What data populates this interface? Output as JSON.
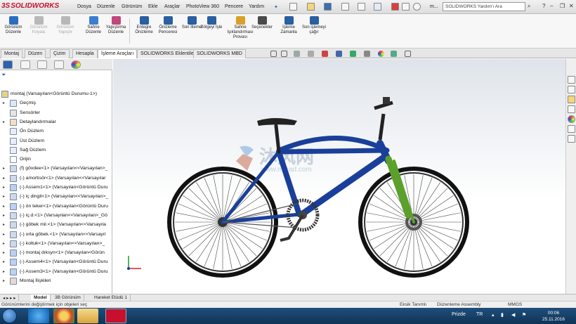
{
  "app": {
    "logo_ds": "3S",
    "logo_name": "SOLIDWORKS"
  },
  "menu": [
    "Dosya",
    "Düzenle",
    "Görünüm",
    "Ekle",
    "Araçlar",
    "PhotoView 360",
    "Pencere",
    "Yardım"
  ],
  "search": {
    "placeholder": "SOLIDWORKS Yardım'ı Ara",
    "user": "m..."
  },
  "ribbon": [
    {
      "label": "Görünüm Düzenle",
      "disabled": false,
      "color": "#2a6fbf"
    },
    {
      "label": "Görünüm Koyala",
      "disabled": true,
      "color": "#b8b8b8"
    },
    {
      "label": "Görünüm Yapıştır",
      "disabled": true,
      "color": "#b8b8b8"
    },
    {
      "label": "Sahne Düzenle",
      "disabled": false,
      "color": "#3a7fcf"
    },
    {
      "label": "Yapıştırma Düzenle",
      "disabled": false,
      "color": "#c0477a"
    },
    {
      "label": "Entegre Önizleme",
      "disabled": false,
      "color": "#2a5fa0"
    },
    {
      "label": "Önizleme Penceresi",
      "disabled": false,
      "color": "#2a5fa0"
    },
    {
      "label": "Son İlleme",
      "disabled": false,
      "color": "#2a5fa0"
    },
    {
      "label": "Bölgeyi İşle",
      "disabled": false,
      "color": "#2a5fa0"
    },
    {
      "label": "Sahne Işıklandırması Provası",
      "disabled": false,
      "color": "#d9a02a"
    },
    {
      "label": "Seçenekler",
      "disabled": false,
      "color": "#4a4a4a"
    },
    {
      "label": "İşleme Zamanla",
      "disabled": false,
      "color": "#2a5fa0"
    },
    {
      "label": "Son işlemeyi çağır",
      "disabled": false,
      "color": "#2a5fa0"
    }
  ],
  "command_tabs": [
    "Montaj",
    "Düzen",
    "Çizim",
    "Hesapla",
    "İşleme Araçları",
    "SOLIDWORKS Eklentileri",
    "SOLIDWORKS MBD"
  ],
  "active_command_tab": "İşleme Araçları",
  "tree": [
    {
      "label": "montaj  (Varsayılan<Görüntü Durumu-1>)",
      "toggle": "",
      "icon": "assembly"
    },
    {
      "label": "Geçmiş",
      "toggle": "▸",
      "icon": "history"
    },
    {
      "label": "Sensörler",
      "toggle": "",
      "icon": "sensor"
    },
    {
      "label": "Detaylandırmalar",
      "toggle": "▸",
      "icon": "annotation"
    },
    {
      "label": "Ön Düzlem",
      "toggle": "",
      "icon": "plane"
    },
    {
      "label": "Üst Düzlem",
      "toggle": "",
      "icon": "plane"
    },
    {
      "label": "Sağ Düzlem",
      "toggle": "",
      "icon": "plane"
    },
    {
      "label": "Orijin",
      "toggle": "",
      "icon": "origin"
    },
    {
      "label": "(f) gövdee<1> (Varsayılan<<Varsayılan>_",
      "toggle": "▸",
      "icon": "part"
    },
    {
      "label": "(-) amortisör<1> (Varsayılan<<Varsayılar",
      "toggle": "▸",
      "icon": "part"
    },
    {
      "label": "(-) Assem1<1> (Varsayılan<Görüntü Duru",
      "toggle": "▸",
      "icon": "subassembly"
    },
    {
      "label": "(-) iç dingil<1> (Varsayılan<<Varsayılan>_",
      "toggle": "▸",
      "icon": "part"
    },
    {
      "label": "(-) ön teker<1> (Varsayılan<Görüntü Duru",
      "toggle": "▸",
      "icon": "subassembly"
    },
    {
      "label": "(-) iç.d.<1> (Varsayılan<<Varsayılan>_Gö",
      "toggle": "▸",
      "icon": "part"
    },
    {
      "label": "(-) göbek mil.<1> (Varsayılan<<Varsayıla",
      "toggle": "▸",
      "icon": "part"
    },
    {
      "label": "(-) orta göbek.<1> (Varsayılan<<Varsayıl",
      "toggle": "▸",
      "icon": "part"
    },
    {
      "label": "(-) koltuk<1> (Varsayılan<<Varsayılan>_",
      "toggle": "▸",
      "icon": "part"
    },
    {
      "label": "(-) montaj dıksyn<1> (Varsayılan<Görün",
      "toggle": "▸",
      "icon": "subassembly"
    },
    {
      "label": "(-) Assem4<1> (Varsayılan<Görüntü Duru",
      "toggle": "▸",
      "icon": "subassembly"
    },
    {
      "label": "(-) Assem3<1> (Varsayılan<Görüntü Duru",
      "toggle": "▸",
      "icon": "subassembly"
    },
    {
      "label": "Montaj İlişkileri",
      "toggle": "▸",
      "icon": "mates"
    }
  ],
  "watermark": {
    "brand": "沐风网",
    "url": "www.mfcad.com"
  },
  "bottom_tabs": [
    "Model",
    "3B Görünüm",
    "Hareket Etüdü 1"
  ],
  "active_bottom_tab": "Model",
  "status": {
    "hint": "Görünümlerini değiştirmek için objeleri seç",
    "constraint": "Eksik Tanımlı",
    "mode": "Düzenleme Assembly",
    "units": "MMGS"
  },
  "taskbar": {
    "lang_label": "Prizde",
    "lang": "TR",
    "time": "00:06",
    "date": "25.11.2016"
  },
  "colors": {
    "frame": "#1a3f9a",
    "fork": "#5aa02a",
    "accent": "#c8102e"
  }
}
